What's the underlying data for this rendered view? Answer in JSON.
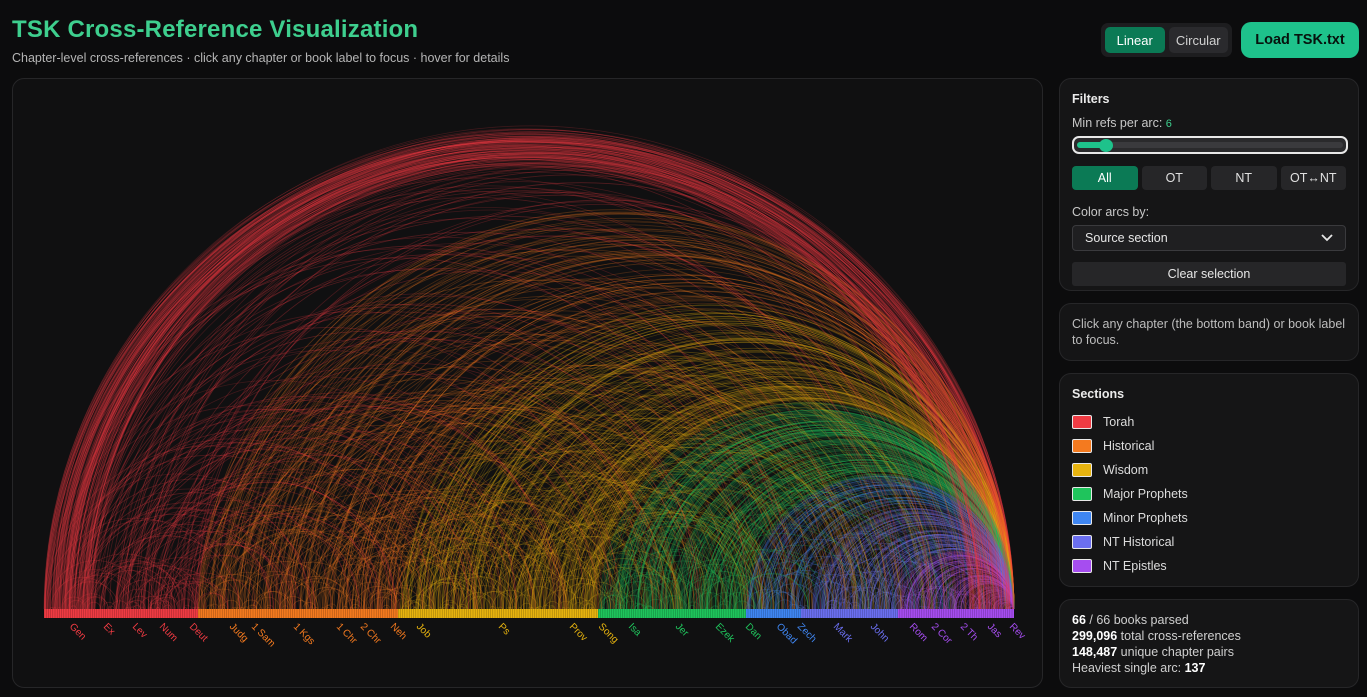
{
  "header": {
    "title": "TSK Cross-Reference Visualization",
    "subtitle": "Chapter-level cross-references · click any chapter or book label to focus · hover for details"
  },
  "mode_toggle": {
    "linear_label": "Linear",
    "circular_label": "Circular",
    "active": "Linear"
  },
  "load_button": {
    "label": "Load TSK.txt"
  },
  "filters": {
    "title": "Filters",
    "min_refs_label": "Min refs per arc:",
    "min_refs_value": "6",
    "min_refs_numeric": 6,
    "scope_buttons": [
      "All",
      "OT",
      "NT",
      "OT↔NT"
    ],
    "scope_active": "All",
    "color_by_label": "Color arcs by:",
    "color_by_value": "Source section",
    "clear_label": "Clear selection"
  },
  "hint": {
    "text": "Click any chapter (the bottom band) or book label to focus."
  },
  "sections": {
    "title": "Sections",
    "items": [
      {
        "name": "Torah",
        "color": "#ef3b43"
      },
      {
        "name": "Historical",
        "color": "#f47a1f"
      },
      {
        "name": "Wisdom",
        "color": "#e7b30f"
      },
      {
        "name": "Major Prophets",
        "color": "#1fc45c"
      },
      {
        "name": "Minor Prophets",
        "color": "#3f86f2"
      },
      {
        "name": "NT Historical",
        "color": "#6b6ff0"
      },
      {
        "name": "NT Epistles",
        "color": "#a64df0"
      }
    ]
  },
  "stats": {
    "books_parsed": "66",
    "books_total": "/ 66 books parsed",
    "total_refs": "299,096",
    "total_refs_label": "total cross-references",
    "pairs": "148,487",
    "pairs_label": "unique chapter pairs",
    "heaviest_label": "Heaviest single arc:",
    "heaviest": "137"
  },
  "book_labels": [
    {
      "text": "Gen",
      "section": 0
    },
    {
      "text": "Ex",
      "section": 0
    },
    {
      "text": "Lev",
      "section": 0
    },
    {
      "text": "Num",
      "section": 0
    },
    {
      "text": "Deut",
      "section": 0
    },
    {
      "text": "Judg",
      "section": 1
    },
    {
      "text": "1 Sam",
      "section": 1
    },
    {
      "text": "1 Kgs",
      "section": 1
    },
    {
      "text": "1 Chr",
      "section": 1
    },
    {
      "text": "2 Chr",
      "section": 1
    },
    {
      "text": "Neh",
      "section": 1
    },
    {
      "text": "Job",
      "section": 2
    },
    {
      "text": "Ps",
      "section": 2
    },
    {
      "text": "Prov",
      "section": 2
    },
    {
      "text": "Song",
      "section": 2
    },
    {
      "text": "Isa",
      "section": 3
    },
    {
      "text": "Jer",
      "section": 3
    },
    {
      "text": "Ezek",
      "section": 3
    },
    {
      "text": "Dan",
      "section": 3
    },
    {
      "text": "Obad",
      "section": 4
    },
    {
      "text": "Zech",
      "section": 4
    },
    {
      "text": "Mark",
      "section": 5
    },
    {
      "text": "John",
      "section": 5
    },
    {
      "text": "Rom",
      "section": 6
    },
    {
      "text": "2 Cor",
      "section": 6
    },
    {
      "text": "2 Th",
      "section": 6
    },
    {
      "text": "Jas",
      "section": 6
    },
    {
      "text": "Rev",
      "section": 6
    }
  ]
}
